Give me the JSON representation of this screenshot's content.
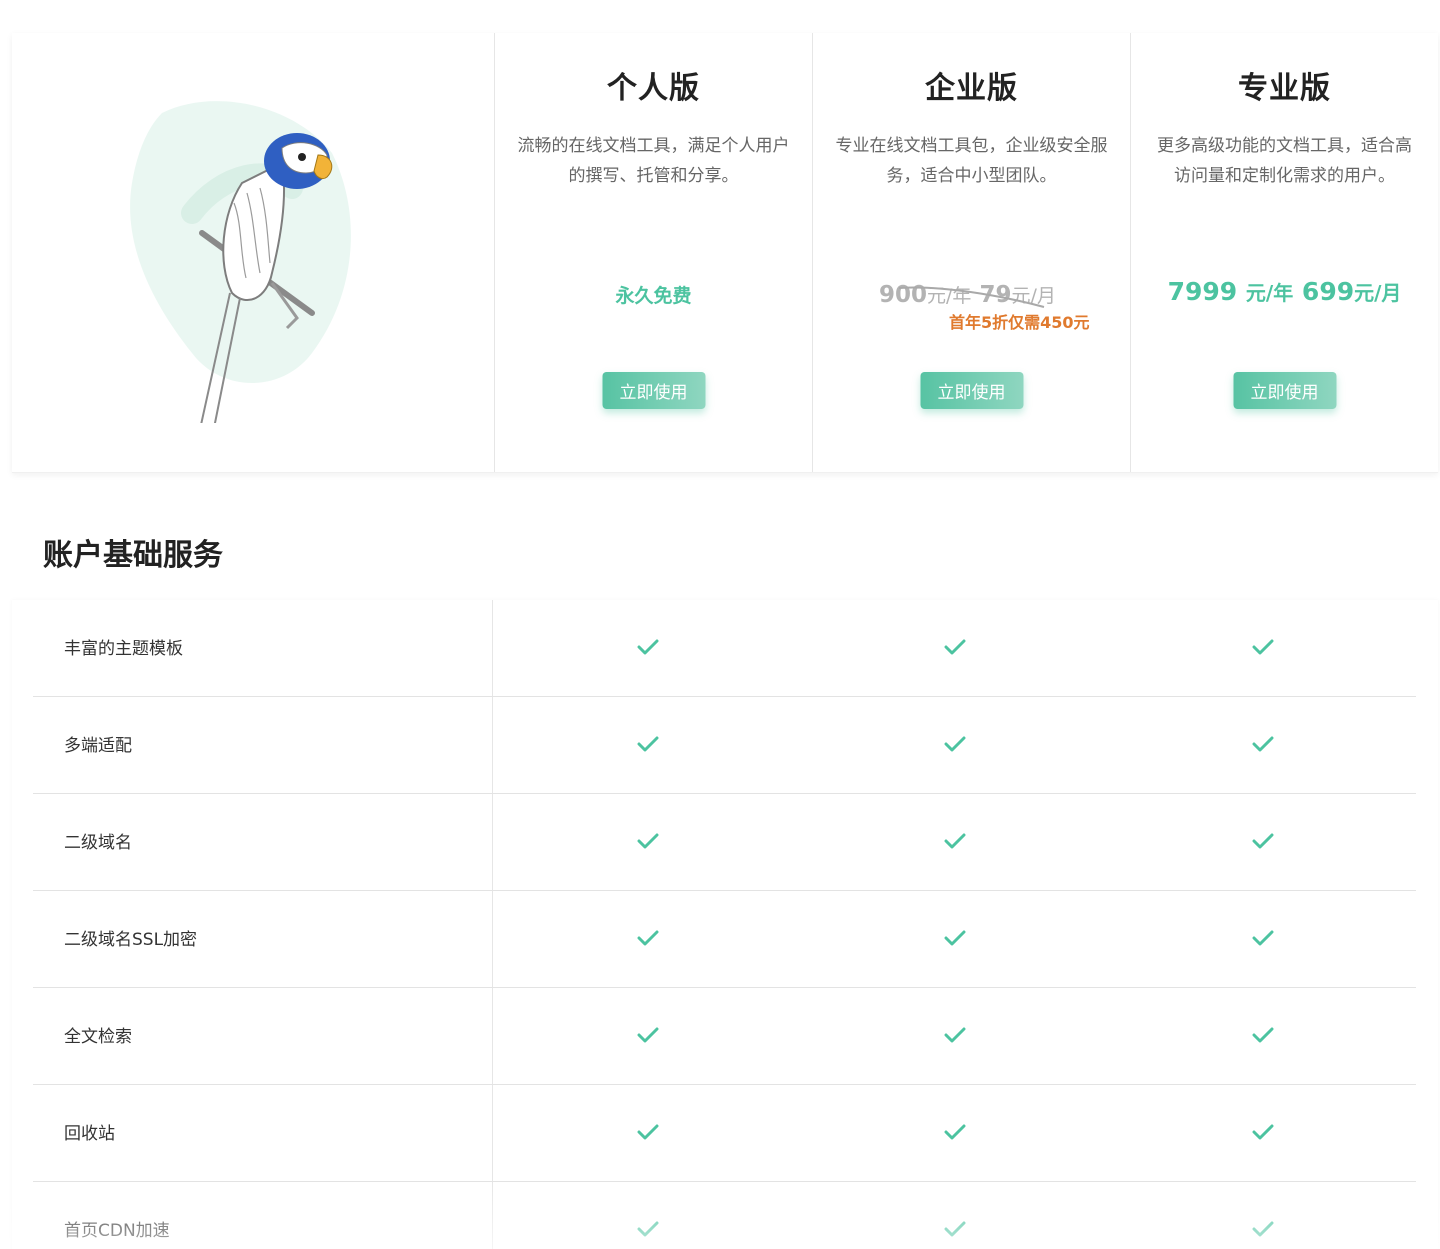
{
  "colors": {
    "accent": "#4cc3a0",
    "promo": "#e07a2e",
    "muted": "#b3b3b3",
    "border": "#e6e6e6"
  },
  "hero": {
    "illustration": "parrot-illustration"
  },
  "plans": [
    {
      "title": "个人版",
      "desc": "流畅的在线文档工具，满足个人用户的撰写、托管和分享。",
      "price": "永久免费",
      "button": "立即使用"
    },
    {
      "title": "企业版",
      "desc": "专业在线文档工具包，企业级安全服务，适合中小型团队。",
      "old_price_year_value": "900",
      "old_price_year_unit": "元/年",
      "old_price_month_value": "79",
      "old_price_month_unit": "元/月",
      "promo": "首年5折仅需450元",
      "button": "立即使用"
    },
    {
      "title": "专业版",
      "desc": "更多高级功能的文档工具，适合高访问量和定制化需求的用户。",
      "price_year_value": "7999",
      "price_year_unit": "元/年",
      "price_month_value": "699",
      "price_month_unit": "元/月",
      "button": "立即使用"
    }
  ],
  "section": {
    "title": "账户基础服务"
  },
  "features": [
    {
      "name": "丰富的主题模板"
    },
    {
      "name": "多端适配"
    },
    {
      "name": "二级域名"
    },
    {
      "name": "二级域名SSL加密"
    },
    {
      "name": "全文检索"
    },
    {
      "name": "回收站"
    },
    {
      "name": "首页CDN加速"
    }
  ],
  "icons": {
    "check": "check-icon"
  }
}
